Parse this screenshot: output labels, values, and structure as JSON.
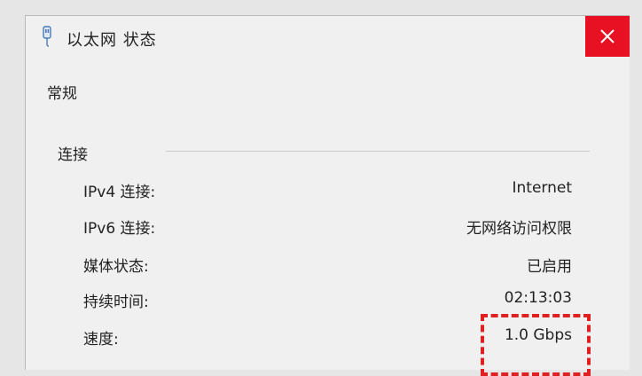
{
  "window": {
    "title": "以太网 状态",
    "close_label": "×",
    "accent_color": "#e81123"
  },
  "tab": {
    "label": "常规"
  },
  "connection": {
    "group_label": "连接",
    "rows": [
      {
        "label": "IPv4 连接:",
        "value": "Internet"
      },
      {
        "label": "IPv6 连接:",
        "value": "无网络访问权限"
      },
      {
        "label": "媒体状态:",
        "value": "已启用"
      },
      {
        "label": "持续时间:",
        "value": "02:13:03"
      },
      {
        "label": "速度:",
        "value": "1.0 Gbps"
      }
    ]
  },
  "annotation": {
    "highlight_color": "#e02020",
    "highlighted_item": "速度"
  },
  "icons": {
    "title_icon": "network-adapter-icon",
    "close_icon": "close-icon"
  }
}
